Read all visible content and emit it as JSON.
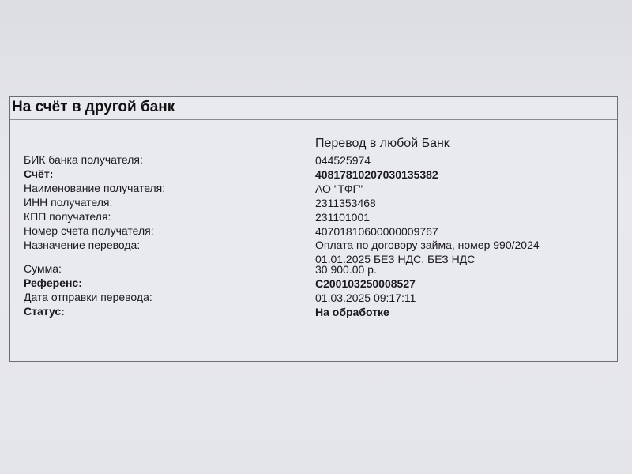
{
  "panel": {
    "title": "На счёт в другой банк",
    "header": "Перевод в любой Банк"
  },
  "fields": {
    "bik": {
      "label": "БИК банка получателя:",
      "value": "044525974"
    },
    "account": {
      "label": "Счёт:",
      "value": "40817810207030135382"
    },
    "recipient_name": {
      "label": "Наименование получателя:",
      "value": "АО \"ТФГ\""
    },
    "inn": {
      "label": "ИНН получателя:",
      "value": "2311353468"
    },
    "kpp": {
      "label": "КПП получателя:",
      "value": "231101001"
    },
    "recipient_account": {
      "label": "Номер счета получателя:",
      "value": "40701810600000009767"
    },
    "purpose": {
      "label": "Назначение перевода:",
      "value_line1": "Оплата по договору займа, номер 990/2024",
      "value_line2": "01.01.2025 БЕЗ НДС. БЕЗ НДС"
    },
    "amount": {
      "label": "Сумма:",
      "value": "30 900.00 р."
    },
    "reference": {
      "label": "Референс:",
      "value": "C200103250008527"
    },
    "send_date": {
      "label": "Дата отправки перевода:",
      "value": "01.03.2025 09:17:11"
    },
    "status": {
      "label": "Статус:",
      "value": "На обработке"
    }
  }
}
